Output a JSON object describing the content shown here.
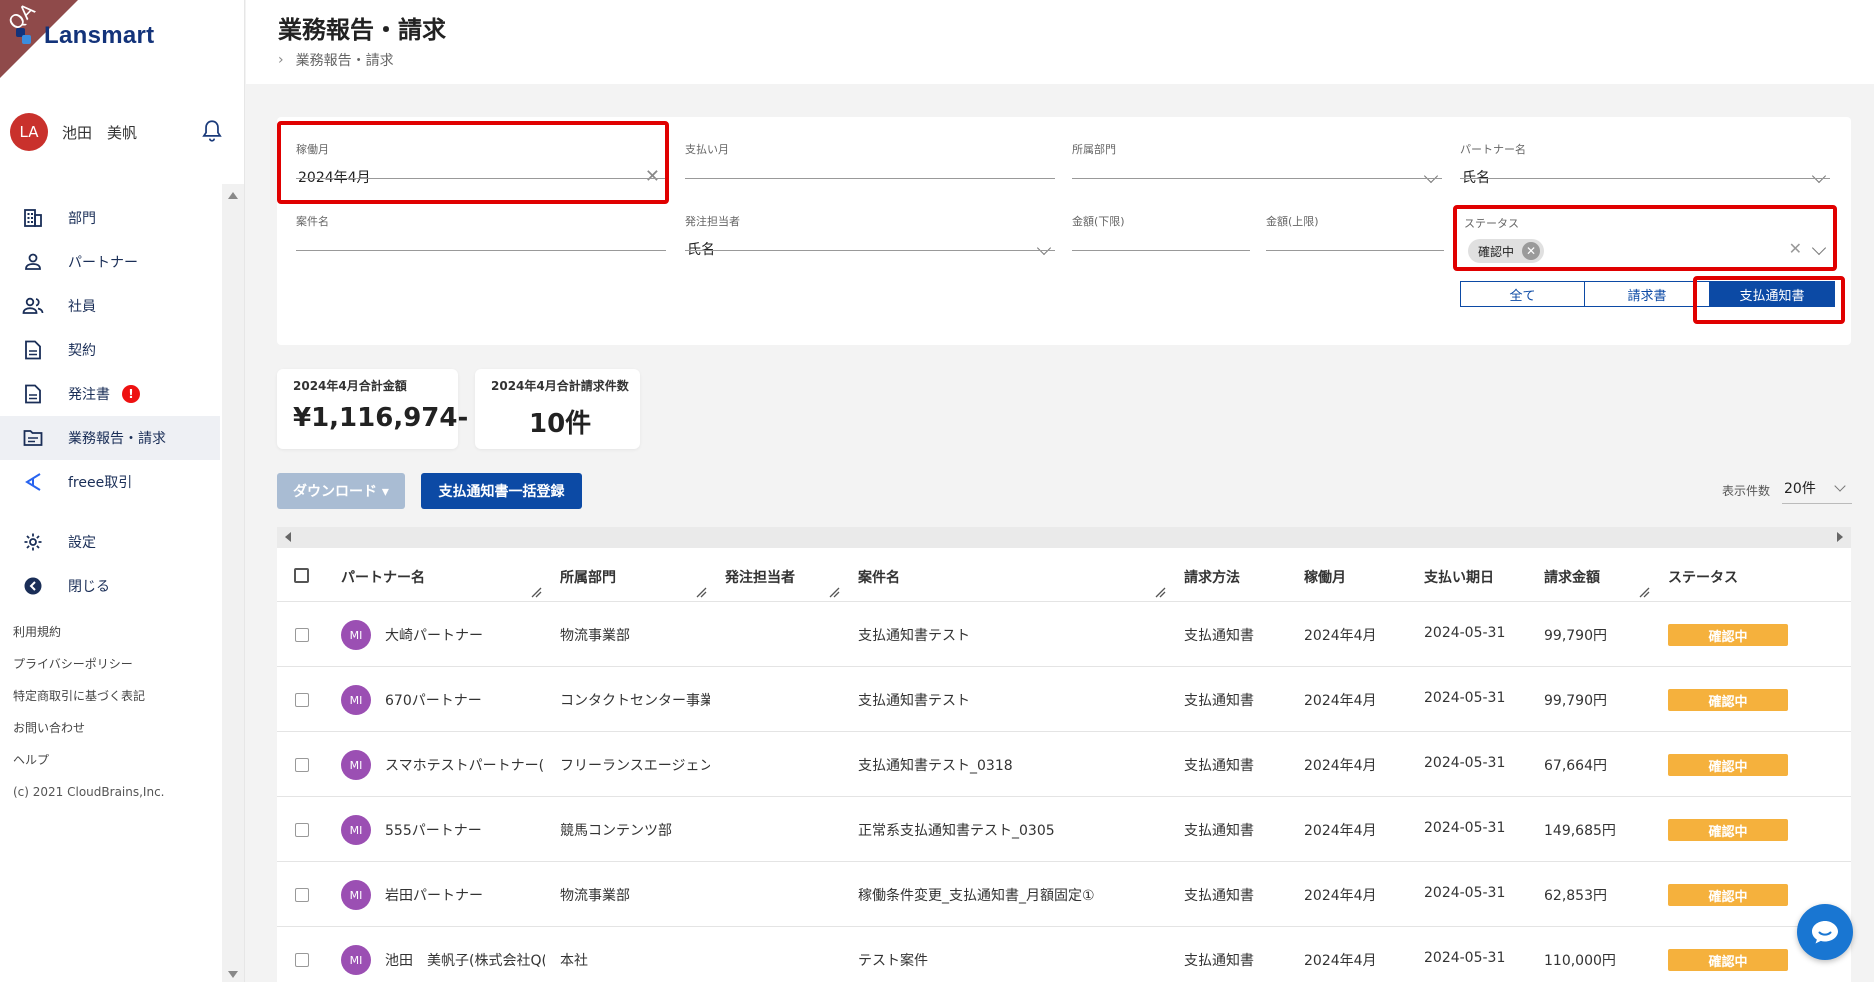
{
  "brand": {
    "qa_label": "QA",
    "logo_text": "Lansmart"
  },
  "user": {
    "initials": "LA",
    "name": "池田　美帆"
  },
  "sidebar": {
    "items": [
      {
        "label": "部門",
        "icon": "building-icon"
      },
      {
        "label": "パートナー",
        "icon": "person-icon"
      },
      {
        "label": "社員",
        "icon": "people-icon"
      },
      {
        "label": "契約",
        "icon": "document-icon"
      },
      {
        "label": "発注書",
        "icon": "document-icon",
        "badge": "!"
      },
      {
        "label": "業務報告・請求",
        "icon": "folder-icon",
        "active": true
      },
      {
        "label": "freee取引",
        "icon": "freee-icon"
      },
      {
        "label": "設定",
        "icon": "gear-icon"
      },
      {
        "label": "閉じる",
        "icon": "back-arrow-icon"
      }
    ],
    "footer": [
      "利用規約",
      "プライバシーポリシー",
      "特定商取引に基づく表記",
      "お問い合わせ",
      "ヘルプ"
    ],
    "copyright": "(c) 2021 CloudBrains,Inc."
  },
  "header": {
    "title": "業務報告・請求",
    "breadcrumb": "業務報告・請求"
  },
  "filters": {
    "working_month": {
      "label": "稼働月",
      "value": "2024年4月"
    },
    "payment_month": {
      "label": "支払い月",
      "value": ""
    },
    "department": {
      "label": "所属部門",
      "value": ""
    },
    "partner_name": {
      "label": "パートナー名",
      "value": "氏名"
    },
    "project_name": {
      "label": "案件名",
      "value": ""
    },
    "order_person": {
      "label": "発注担当者",
      "value": "氏名"
    },
    "amount_min": {
      "label": "金額(下限)",
      "value": ""
    },
    "amount_max": {
      "label": "金額(上限)",
      "value": ""
    },
    "status": {
      "label": "ステータス",
      "chip": "確認中"
    },
    "segments": [
      "全て",
      "請求書",
      "支払通知書"
    ],
    "segment_selected": "支払通知書"
  },
  "summary": {
    "total_amount_label": "2024年4月合計金額",
    "total_amount": "¥1,116,974-",
    "total_count_label": "2024年4月合計請求件数",
    "total_count": "10件"
  },
  "actions": {
    "download": "ダウンロード ▾",
    "bulk_register": "支払通知書一括登録",
    "per_page_label": "表示件数",
    "per_page": "20件"
  },
  "table": {
    "columns": [
      "パートナー名",
      "所属部門",
      "発注担当者",
      "案件名",
      "請求方法",
      "稼働月",
      "支払い期日",
      "請求金額",
      "ステータス"
    ],
    "rows": [
      {
        "avatar": "MI",
        "partner": "大崎パートナー",
        "dept": "物流事業部",
        "person": "",
        "project": "支払通知書テスト",
        "method": "支払通知書",
        "month": "2024年4月",
        "due": "2024-05-31",
        "amount": "99,790円",
        "status": "確認中"
      },
      {
        "avatar": "MI",
        "partner": "670パートナー",
        "dept": "コンタクトセンター事業",
        "person": "",
        "project": "支払通知書テスト",
        "method": "支払通知書",
        "month": "2024年4月",
        "due": "2024-05-31",
        "amount": "99,790円",
        "status": "確認中"
      },
      {
        "avatar": "MI",
        "partner": "スマホテストパートナー(",
        "dept": "フリーランスエージェン",
        "person": "",
        "project": "支払通知書テスト_0318",
        "method": "支払通知書",
        "month": "2024年4月",
        "due": "2024-05-31",
        "amount": "67,664円",
        "status": "確認中"
      },
      {
        "avatar": "MI",
        "partner": "555パートナー",
        "dept": "競馬コンテンツ部",
        "person": "",
        "project": "正常系支払通知書テスト_0305",
        "method": "支払通知書",
        "month": "2024年4月",
        "due": "2024-05-31",
        "amount": "149,685円",
        "status": "確認中"
      },
      {
        "avatar": "MI",
        "partner": "岩田パートナー",
        "dept": "物流事業部",
        "person": "",
        "project": "稼働条件変更_支払通知書_月額固定①",
        "method": "支払通知書",
        "month": "2024年4月",
        "due": "2024-05-31",
        "amount": "62,853円",
        "status": "確認中"
      },
      {
        "avatar": "MI",
        "partner": "池田　美帆子(株式会社Q(",
        "dept": "本社",
        "person": "",
        "project": "テスト案件",
        "method": "支払通知書",
        "month": "2024年4月",
        "due": "2024-05-31",
        "amount": "110,000円",
        "status": "確認中"
      }
    ]
  },
  "colors": {
    "brand": "#13337a",
    "primary": "#0c4aa5",
    "status_pending": "#f5b13d",
    "highlight": "#e00000",
    "avatar_partner": "#9b4fb3"
  }
}
